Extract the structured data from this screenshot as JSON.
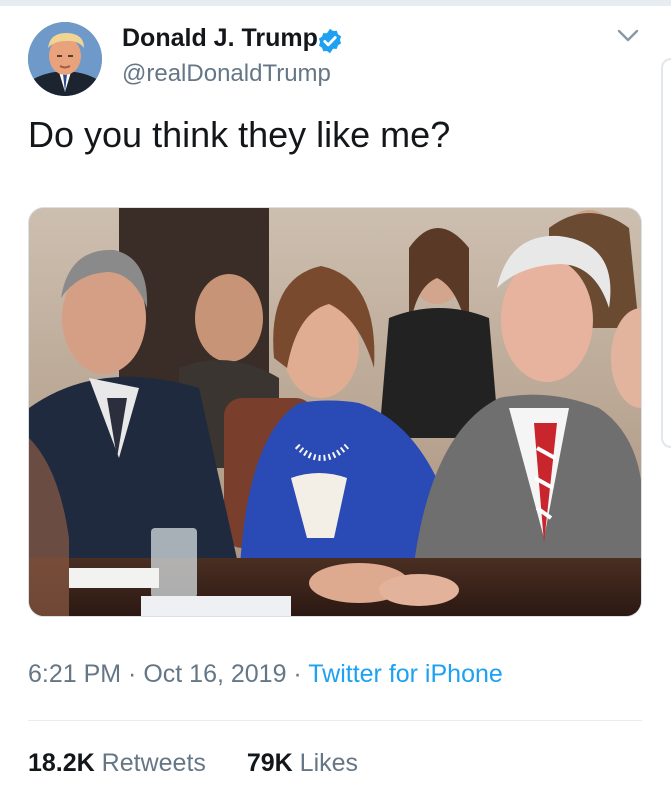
{
  "tweet": {
    "author": {
      "display_name": "Donald J. Trump",
      "handle": "@realDonaldTrump",
      "verified": true
    },
    "text": "Do you think they like me?",
    "timestamp": {
      "time": "6:21 PM",
      "separator": " · ",
      "date": "Oct 16, 2019",
      "source_separator": " · ",
      "source": "Twitter for iPhone"
    },
    "stats": {
      "retweets_count": "18.2K",
      "retweets_label": "Retweets",
      "likes_count": "79K",
      "likes_label": "Likes"
    }
  },
  "colors": {
    "accent": "#1da1f2",
    "text_primary": "#14171a",
    "text_secondary": "#657786",
    "divider": "#e6ecf0"
  },
  "icons": {
    "verified": "verified-badge-icon",
    "more": "chevron-down-icon"
  }
}
